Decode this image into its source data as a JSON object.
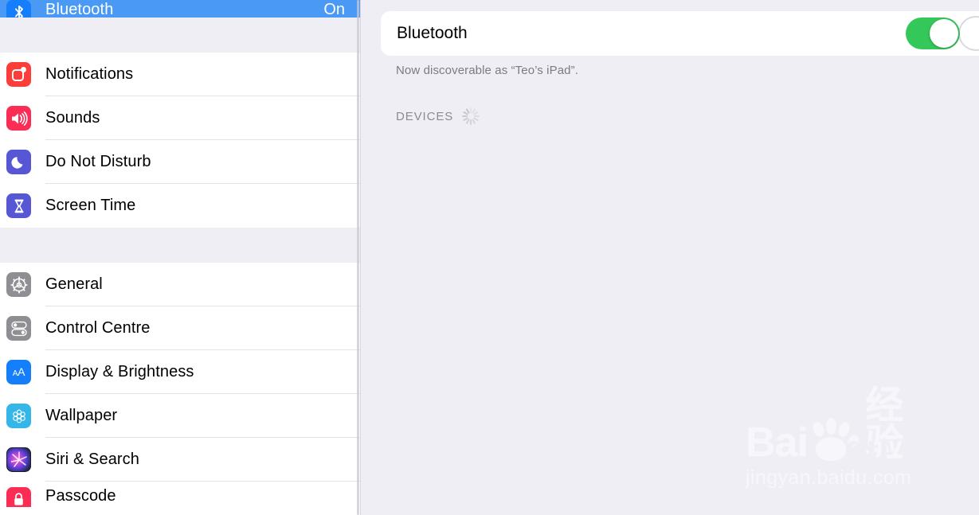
{
  "sidebar": {
    "groups": [
      {
        "rows": [
          {
            "label": "Bluetooth",
            "value": "On",
            "icon": "bluetooth-icon",
            "icon_key": "bt",
            "selected": true,
            "clipped_top": true
          }
        ]
      },
      {
        "rows": [
          {
            "label": "Notifications",
            "value": "",
            "icon": "notifications-icon",
            "icon_key": "notif",
            "selected": false
          },
          {
            "label": "Sounds",
            "value": "",
            "icon": "speaker-icon",
            "icon_key": "sounds",
            "selected": false
          },
          {
            "label": "Do Not Disturb",
            "value": "",
            "icon": "moon-icon",
            "icon_key": "dnd",
            "selected": false
          },
          {
            "label": "Screen Time",
            "value": "",
            "icon": "hourglass-icon",
            "icon_key": "screentime",
            "selected": false
          }
        ]
      },
      {
        "rows": [
          {
            "label": "General",
            "value": "",
            "icon": "gear-icon",
            "icon_key": "general",
            "selected": false
          },
          {
            "label": "Control Centre",
            "value": "",
            "icon": "toggles-icon",
            "icon_key": "control",
            "selected": false
          },
          {
            "label": "Display & Brightness",
            "value": "",
            "icon": "text-size-icon",
            "icon_key": "display",
            "selected": false
          },
          {
            "label": "Wallpaper",
            "value": "",
            "icon": "flower-icon",
            "icon_key": "wallpaper",
            "selected": false
          },
          {
            "label": "Siri & Search",
            "value": "",
            "icon": "siri-icon",
            "icon_key": "siri",
            "selected": false
          },
          {
            "label": "Passcode",
            "value": "",
            "icon": "lock-icon",
            "icon_key": "passcode",
            "selected": false,
            "clipped_bottom": true
          }
        ]
      }
    ]
  },
  "detail": {
    "title": "Bluetooth",
    "toggle_state": "on",
    "discoverable_text": "Now discoverable as “Teo’s iPad”.",
    "devices_header": "DEVICES",
    "spinner": "activity-spinner"
  },
  "watermark": {
    "brand_latin": "Bai",
    "brand_du": "du",
    "brand_cn": "经验",
    "url": "jingyan.baidu.com"
  },
  "colors": {
    "accent_blue": "#4a9af5",
    "toggle_green": "#34c759",
    "panel_bg": "#efeef5",
    "row_bg": "#ffffff",
    "separator": "#e3e2e8",
    "secondary_text": "#8e8e93"
  }
}
